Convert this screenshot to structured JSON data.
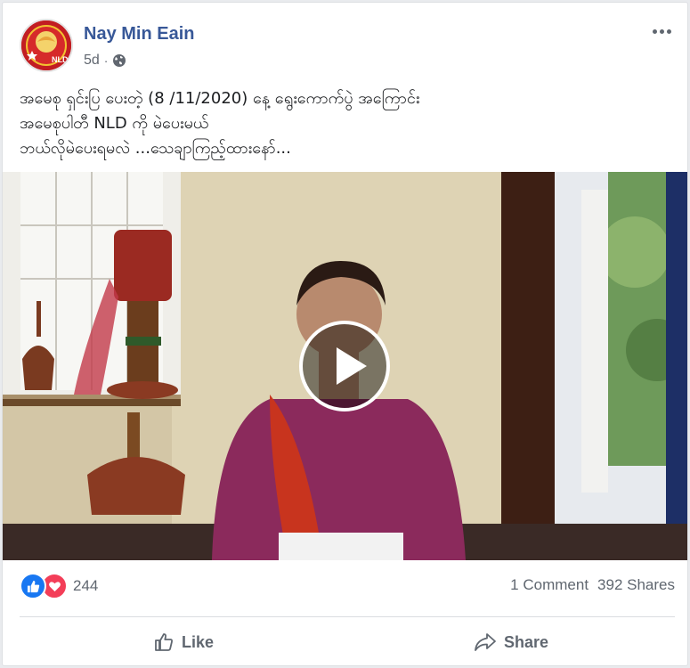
{
  "post": {
    "author": "Nay Min Eain",
    "time": "5d",
    "separator": "·",
    "privacy_icon": "globe-icon",
    "more_icon": "more-options-icon",
    "text_lines": [
      "အမေစု ရှင်းပြ ပေးတဲ့ (8 /11/2020) နေ့ ရွေးကောက်ပွဲ အကြောင်း",
      "အမေစုပါတီ NLD ကို မဲပေးမယ်",
      "ဘယ်လိုမဲပေးရမလဲ ...သေချာကြည့်ထားနော်..."
    ],
    "avatar_badge": "NLD"
  },
  "video": {
    "play_icon": "play-icon"
  },
  "stats": {
    "reaction_icons": [
      "like-reaction-icon",
      "love-reaction-icon"
    ],
    "reactions_count": "244",
    "comments": "1 Comment",
    "shares": "392 Shares"
  },
  "actions": {
    "like_label": "Like",
    "share_label": "Share"
  },
  "colors": {
    "author_link": "#385898",
    "like_blue": "#1877f2",
    "love_red": "#f33e58",
    "secondary_text": "#606770"
  }
}
